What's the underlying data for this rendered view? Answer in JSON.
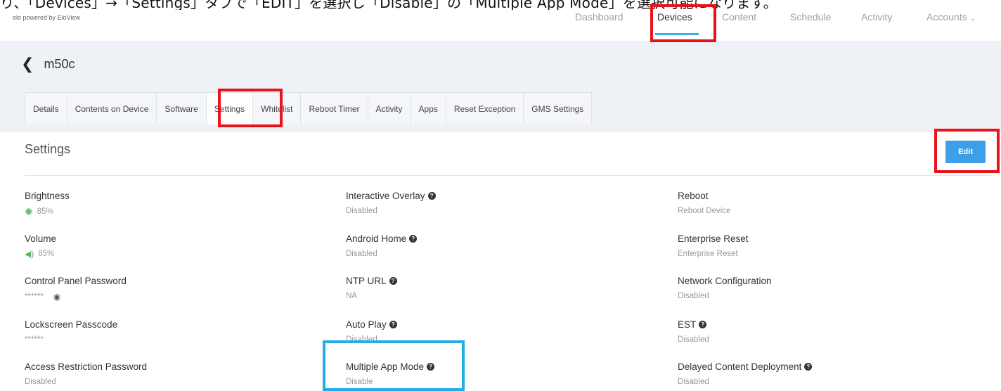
{
  "caption": "り、「Devices」→「Settings」タブで「EDIT」を選択し「Disable」の「Multiple App Mode」を選択可能になります。",
  "logo": {
    "subtitle": "elo powered by EloView"
  },
  "topnav": {
    "items": [
      "Dashboard",
      "Devices",
      "Content",
      "Schedule",
      "Activity",
      "Accounts"
    ],
    "active": "Devices"
  },
  "device": {
    "name": "m50c"
  },
  "tabs": [
    "Details",
    "Contents on Device",
    "Software",
    "Settings",
    "Whitelist",
    "Reboot Timer",
    "Activity",
    "Apps",
    "Reset Exception",
    "GMS Settings"
  ],
  "active_tab": "Settings",
  "section": {
    "title": "Settings",
    "edit_label": "Edit"
  },
  "settings": {
    "col1": [
      {
        "label": "Brightness",
        "value": "85%",
        "icon": "brightness-icon"
      },
      {
        "label": "Volume",
        "value": "85%",
        "icon": "volume-icon"
      },
      {
        "label": "Control Panel Password",
        "value": "******",
        "icon": "eye-icon"
      },
      {
        "label": "Lockscreen Passcode",
        "value": "******"
      },
      {
        "label": "Access Restriction Password",
        "value": "Disabled"
      }
    ],
    "col2": [
      {
        "label": "Interactive Overlay",
        "value": "Disabled"
      },
      {
        "label": "Android Home",
        "value": "Disabled"
      },
      {
        "label": "NTP URL",
        "value": "NA"
      },
      {
        "label": "Auto Play",
        "value": "Disabled"
      },
      {
        "label": "Multiple App Mode",
        "value": "Disable"
      }
    ],
    "col3": [
      {
        "label": "Reboot",
        "value": "Reboot Device"
      },
      {
        "label": "Enterprise Reset",
        "value": "Enterprise Reset"
      },
      {
        "label": "Network Configuration",
        "value": "Disabled"
      },
      {
        "label": "EST",
        "value": "Disabled"
      },
      {
        "label": "Delayed Content Deployment",
        "value": "Disabled"
      }
    ]
  },
  "colors": {
    "highlight_red": "#e8141b",
    "highlight_blue": "#1eaee8",
    "accent": "#3e9ee8"
  }
}
